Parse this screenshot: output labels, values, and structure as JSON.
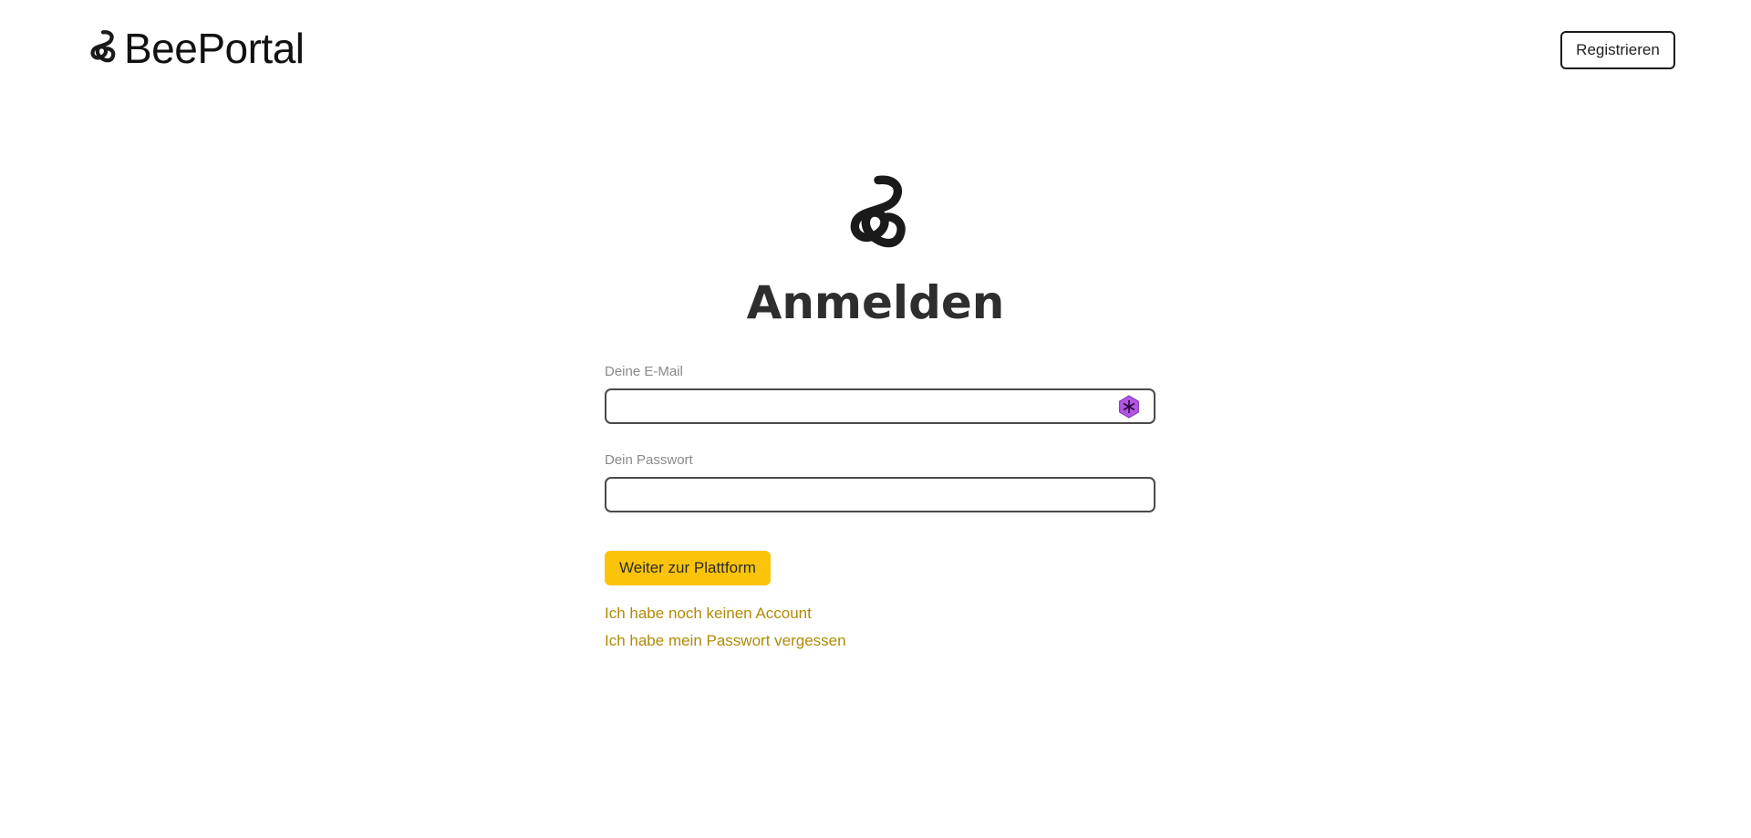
{
  "header": {
    "brand_name": "BeePortal",
    "logo_icon": "bee-loop-logo-icon",
    "register_label": "Registrieren"
  },
  "hero": {
    "logo_icon": "bee-loop-logo-icon",
    "title": "Anmelden"
  },
  "form": {
    "email_label": "Deine E-Mail",
    "email_value": "",
    "email_extension_icon": "password-manager-icon",
    "password_label": "Dein Passwort",
    "password_value": "",
    "submit_label": "Weiter zur Plattform"
  },
  "links": {
    "no_account": "Ich habe noch keinen Account",
    "forgot_password": "Ich habe mein Passwort vergessen"
  },
  "colors": {
    "accent": "#fbc40a",
    "link": "#b08a06",
    "text_dark": "#2e2e2e",
    "label_gray": "#8a8a8a",
    "extension_purple": "#b455e6"
  }
}
